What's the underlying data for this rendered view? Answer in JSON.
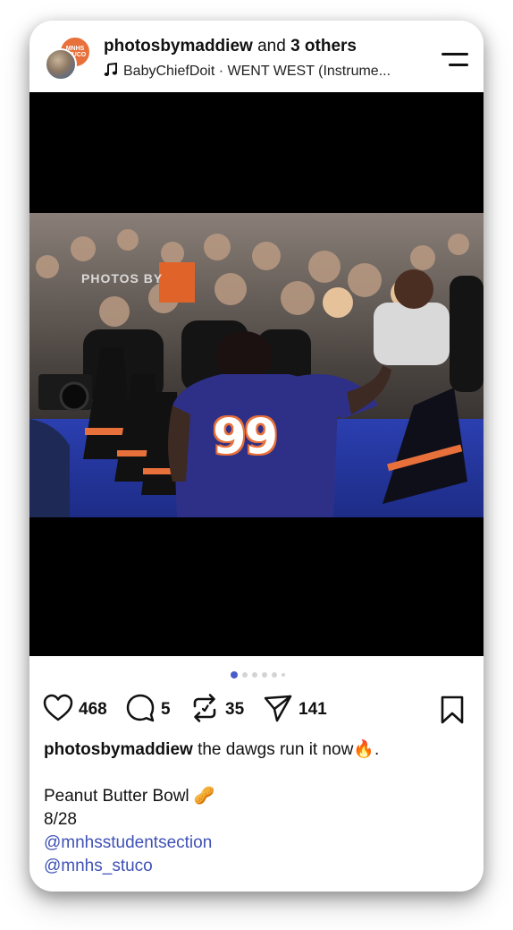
{
  "header": {
    "username": "photosbymaddiew",
    "and_text": " and ",
    "others": "3 others",
    "music": "BabyChiefDoit · WENT WEST (Instrume...",
    "avatar_back_text": "MNHS STUCO"
  },
  "photo": {
    "watermark": "PHOTOS BY",
    "jersey_number": "99"
  },
  "carousel": {
    "current_index": 1,
    "total": 6
  },
  "actions": {
    "likes": "468",
    "comments": "5",
    "reposts": "35",
    "shares": "141"
  },
  "caption": {
    "username": "photosbymaddiew",
    "text": " the dawgs run it now🔥.",
    "line2": "Peanut Butter Bowl 🥜",
    "line3": "8/28",
    "mention1": "@mnhsstudentsection",
    "mention2": "@mnhs_stuco"
  },
  "colors": {
    "accent": "#3f51b5",
    "carousel_active": "#4a5cc7",
    "avatar_orange": "#e8703a"
  },
  "icons": {
    "music": "music-note-icon",
    "menu": "menu-lines-icon",
    "like": "heart-icon",
    "comment": "comment-bubble-icon",
    "repost": "repost-icon",
    "share": "send-icon",
    "save": "bookmark-icon"
  }
}
